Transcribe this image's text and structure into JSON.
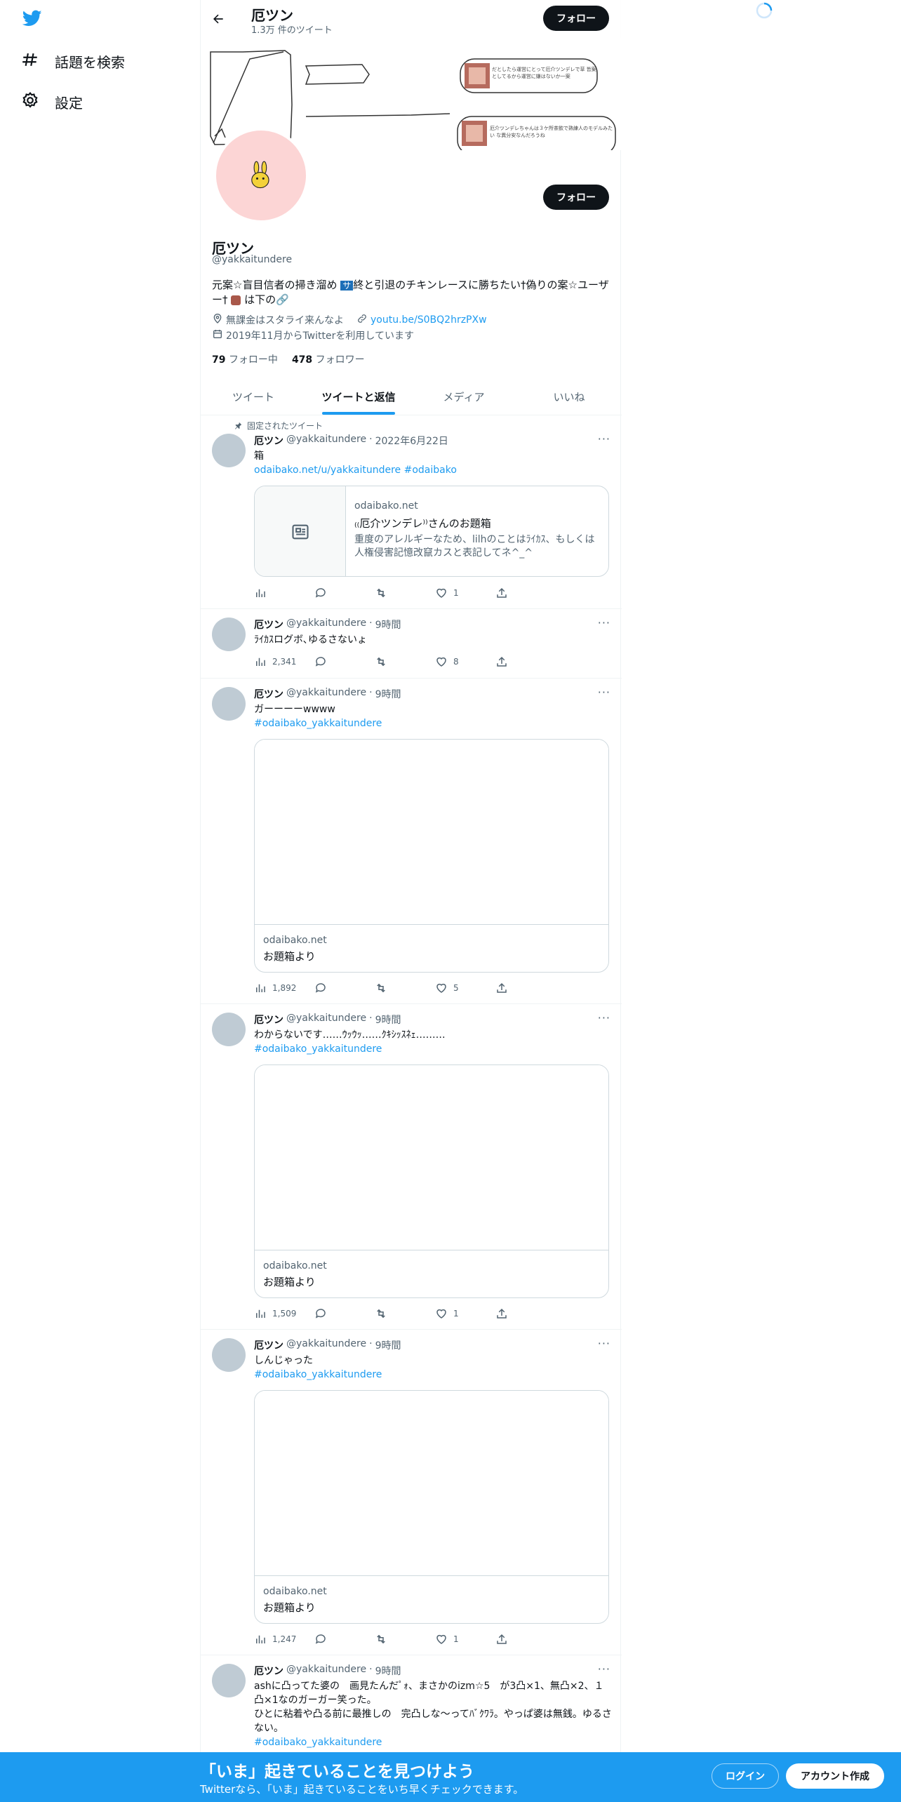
{
  "nav": {
    "explore_label": "話題を検索",
    "settings_label": "設定"
  },
  "header": {
    "name": "厄ツン",
    "tweet_count": "1.3万 件のツイート",
    "follow_label": "フォロー"
  },
  "banner": {
    "box1_text": "だとしたら運営にとって厄介ツンデレで草 皆案としてるから運営に嫌はないか一案",
    "box2_text": "厄介ツンデレちゃんは３ケ所茶飲で熟練人のモデルみたい な異分安なんだろうね"
  },
  "profile": {
    "name": "厄ツン",
    "handle": "@yakkaitundere",
    "bio_part1": "元案☆盲目信者の掃き溜め",
    "bio_badge": "サ",
    "bio_part2": "終と引退のチキンレースに勝ちたい†偽りの案☆ユーザー†",
    "bio_part3": "は下の🔗",
    "location": "無課金はスタライ来んなよ",
    "website": "youtu.be/S0BQ2hrzPXw",
    "joined": "2019年11月からTwitterを利用しています",
    "following_count": "79",
    "following_label": "フォロー中",
    "followers_count": "478",
    "followers_label": "フォロワー",
    "follow_label": "フォロー"
  },
  "tabs": [
    "ツイート",
    "ツイートと返信",
    "メディア",
    "いいね"
  ],
  "pinned_label": "固定されたツイート",
  "tweets": [
    {
      "name": "厄ツン",
      "handle": "@yakkaitundere",
      "time": "2022年6月22日",
      "text": "箱",
      "link_text": "odaibako.net/u/yakkaitundere",
      "hashtag": "#odaibako",
      "card_domain": "odaibako.net",
      "card_title": "₍₍厄介ツンデレ⁾⁾さんのお題箱",
      "card_desc": "重度のアレルギーなため、lilhのことはﾗｲｶｽ、もしくは人権侵害記憶改竄カスと表記してネ^_^",
      "views": "",
      "likes": "1"
    },
    {
      "name": "厄ツン",
      "handle": "@yakkaitundere",
      "time": "9時間",
      "text": "ﾗｲｶｽログボ､ゆるさないょ",
      "views": "2,341",
      "likes": "8"
    },
    {
      "name": "厄ツン",
      "handle": "@yakkaitundere",
      "time": "9時間",
      "text": "ガーーーーwwww",
      "hashtag": "#odaibako_yakkaitundere",
      "card_domain": "odaibako.net",
      "card_title": "お題箱より",
      "views": "1,892",
      "likes": "5"
    },
    {
      "name": "厄ツン",
      "handle": "@yakkaitundere",
      "time": "9時間",
      "text": "わからないです……ｳｯｳｯ……ｸｷｼｯｽﾈｪ………",
      "hashtag": "#odaibako_yakkaitundere",
      "card_domain": "odaibako.net",
      "card_title": "お題箱より",
      "views": "1,509",
      "likes": "1"
    },
    {
      "name": "厄ツン",
      "handle": "@yakkaitundere",
      "time": "9時間",
      "text": "しんじゃった",
      "hashtag": "#odaibako_yakkaitundere",
      "card_domain": "odaibako.net",
      "card_title": "お題箱より",
      "views": "1,247",
      "likes": "1"
    },
    {
      "name": "厄ツン",
      "handle": "@yakkaitundere",
      "time": "9時間",
      "text_line1": "ashに凸ってた婆の　画見たんだﾟｫ、まさかのizm☆5　が3凸×1、無凸×2、１凸×1なのガーガー笑った。",
      "text_line2": "ひとに粘着や凸る前に最推しの　完凸しな〜ってﾊﾞｸﾜﾗ。やっぱ婆は無銭。ゆるさない。",
      "hashtag": "#odaibako_yakkaitundere"
    }
  ],
  "signup_bar": {
    "title": "「いま」起きていることを見つけよう",
    "subtitle": "Twitterなら、「いま」起きていることをいち早くチェックできます。",
    "login_label": "ログイン",
    "create_label": "アカウント作成"
  },
  "colors": {
    "accent": "#1d9bf0",
    "avatar_bg": "#fcd5d5",
    "placeholder_avatar": "#bfcbd4"
  }
}
